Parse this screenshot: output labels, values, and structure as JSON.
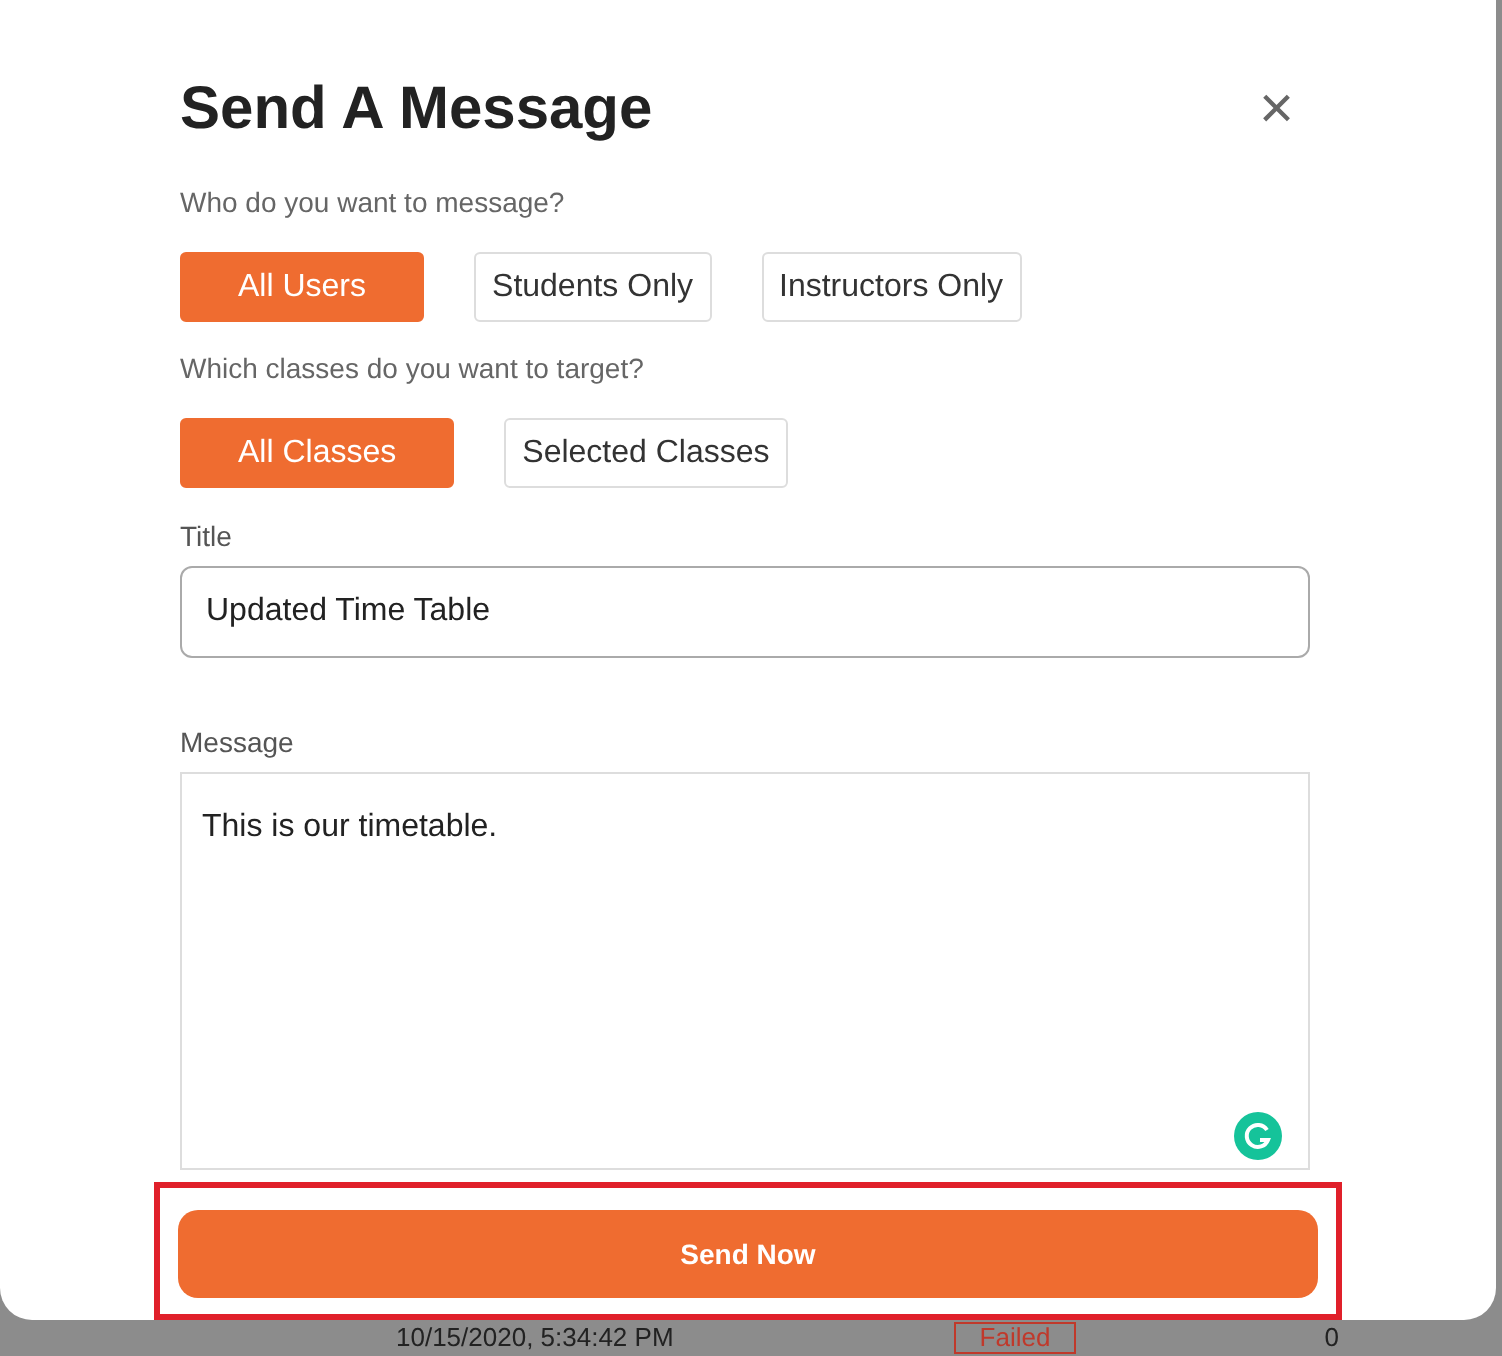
{
  "dialog": {
    "title": "Send A Message",
    "close": "×"
  },
  "audience": {
    "label": "Who do you want to message?",
    "options": [
      {
        "label": "All Users",
        "selected": true
      },
      {
        "label": "Students Only",
        "selected": false
      },
      {
        "label": "Instructors Only",
        "selected": false
      }
    ]
  },
  "classes": {
    "label": "Which classes do you want to target?",
    "options": [
      {
        "label": "All Classes",
        "selected": true
      },
      {
        "label": "Selected Classes",
        "selected": false
      }
    ]
  },
  "title_field": {
    "label": "Title",
    "value": "Updated Time Table"
  },
  "message_field": {
    "label": "Message",
    "value": "This is our timetable."
  },
  "send_button": {
    "label": "Send Now",
    "highlighted": true
  },
  "background_row": {
    "date": "10/15/2020, 5:34:42 PM",
    "status": "Failed",
    "count": "0"
  }
}
